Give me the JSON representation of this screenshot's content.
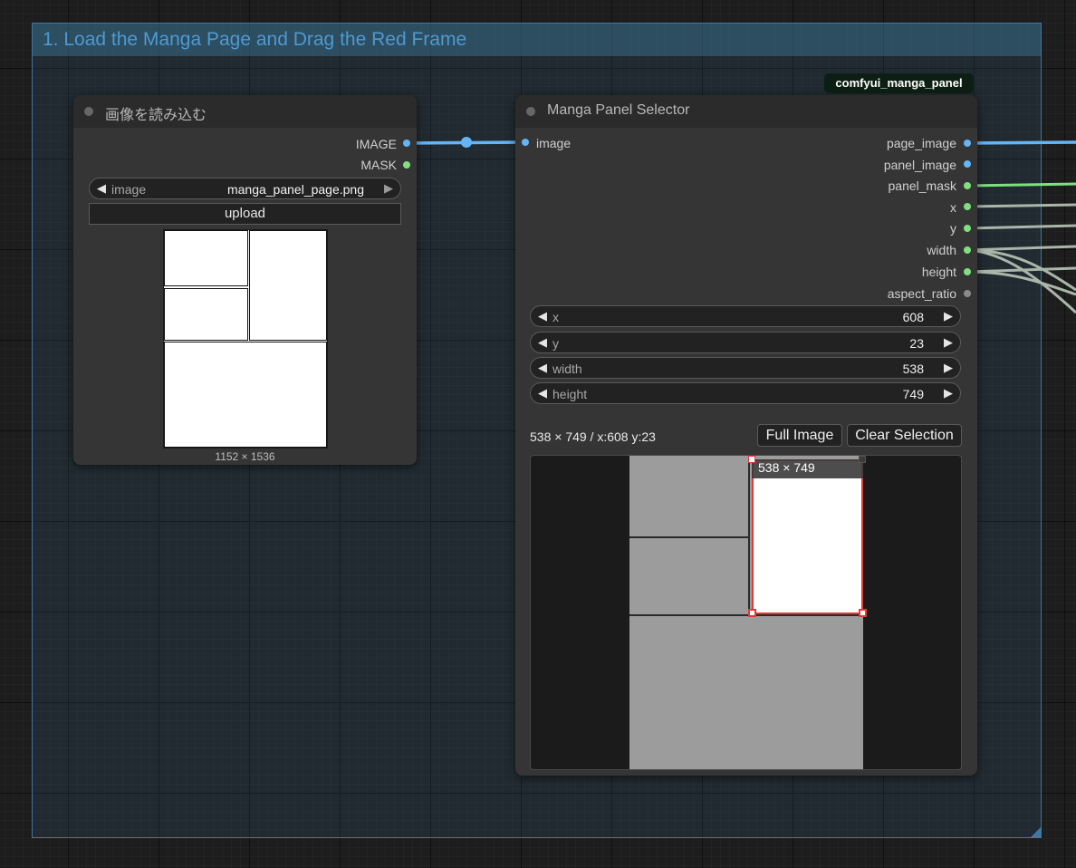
{
  "group": {
    "title": "1. Load the Manga Page and Drag the Red Frame"
  },
  "badge": {
    "text": "comfyui_manga_panel"
  },
  "load_image_node": {
    "title": "画像を読み込む",
    "outputs": [
      {
        "label": "IMAGE",
        "type": "image"
      },
      {
        "label": "MASK",
        "type": "mask"
      }
    ],
    "image_widget": {
      "label": "image",
      "value": "manga_panel_page.png"
    },
    "upload_label": "upload",
    "image_size": "1152 × 1536"
  },
  "manga_node": {
    "title": "Manga Panel Selector",
    "input": {
      "label": "image"
    },
    "outputs": [
      {
        "label": "page_image"
      },
      {
        "label": "panel_image"
      },
      {
        "label": "panel_mask"
      },
      {
        "label": "x"
      },
      {
        "label": "y"
      },
      {
        "label": "width"
      },
      {
        "label": "height"
      },
      {
        "label": "aspect_ratio"
      }
    ],
    "widgets": [
      {
        "label": "x",
        "value": "608"
      },
      {
        "label": "y",
        "value": "23"
      },
      {
        "label": "width",
        "value": "538"
      },
      {
        "label": "height",
        "value": "749"
      }
    ],
    "selection_info": "538 × 749 / x:608 y:23",
    "full_image_label": "Full Image",
    "clear_selection_label": "Clear Selection",
    "selection_label": "538 × 749"
  },
  "colors": {
    "image_link": "#64b5f6",
    "mask_link": "#7ee07e",
    "int_link": "#a9b6a9",
    "selection_frame": "#e53935",
    "group_title": "#4d9ad0"
  }
}
